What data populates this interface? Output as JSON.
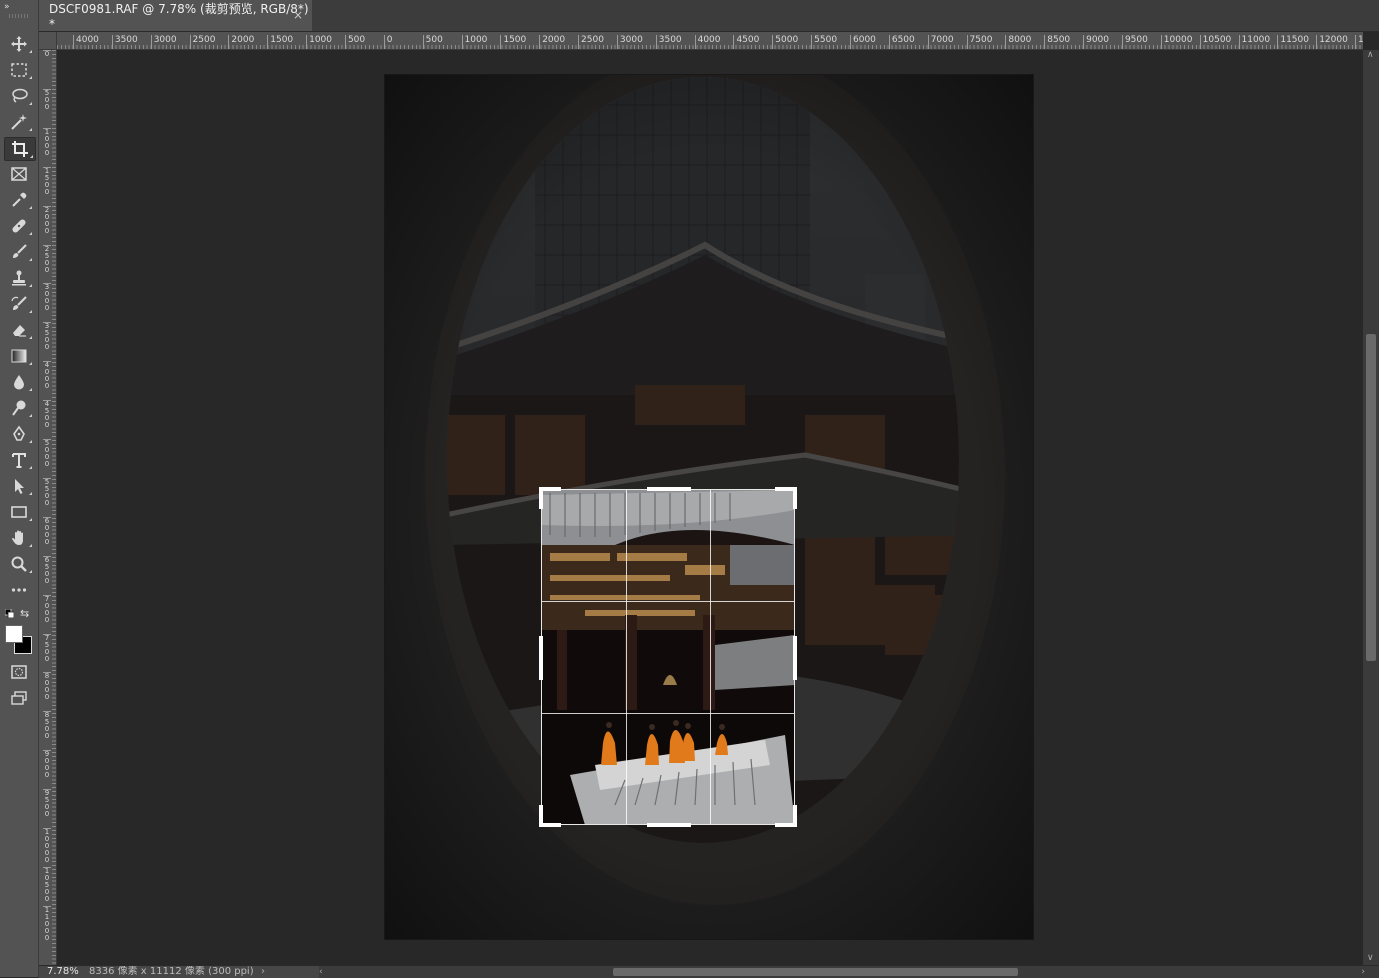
{
  "window": {
    "toolbar_collapse": "»",
    "tab_title": "DSCF0981.RAF @ 7.78% (裁剪预览, RGB/8*) *",
    "tab_close": "×"
  },
  "tools": [
    {
      "name": "move-tool",
      "icon": "move-icon"
    },
    {
      "name": "marquee-tool",
      "icon": "rect-marquee-icon"
    },
    {
      "name": "lasso-tool",
      "icon": "lasso-icon"
    },
    {
      "name": "magic-wand-tool",
      "icon": "magic-wand-icon"
    },
    {
      "name": "crop-tool",
      "icon": "crop-icon",
      "active": true
    },
    {
      "name": "frame-tool",
      "icon": "frame-icon"
    },
    {
      "name": "eyedropper-tool",
      "icon": "eyedropper-icon"
    },
    {
      "name": "healing-tool",
      "icon": "bandage-icon"
    },
    {
      "name": "brush-tool",
      "icon": "brush-icon"
    },
    {
      "name": "stamp-tool",
      "icon": "stamp-icon"
    },
    {
      "name": "history-brush-tool",
      "icon": "history-brush-icon"
    },
    {
      "name": "eraser-tool",
      "icon": "eraser-icon"
    },
    {
      "name": "gradient-tool",
      "icon": "gradient-icon"
    },
    {
      "name": "blur-tool",
      "icon": "drop-icon"
    },
    {
      "name": "dodge-tool",
      "icon": "dodge-icon"
    },
    {
      "name": "pen-tool",
      "icon": "pen-icon"
    },
    {
      "name": "type-tool",
      "icon": "type-icon"
    },
    {
      "name": "path-selection-tool",
      "icon": "arrow-select-icon"
    },
    {
      "name": "shape-tool",
      "icon": "rectangle-icon"
    },
    {
      "name": "hand-tool",
      "icon": "hand-icon"
    },
    {
      "name": "zoom-tool",
      "icon": "magnifier-icon"
    },
    {
      "name": "more-tools",
      "icon": "ellipsis-icon"
    }
  ],
  "colors": {
    "foreground": "#ffffff",
    "background": "#000000",
    "swap_glyph": "⇆"
  },
  "ruler": {
    "h_labels": [
      "4000",
      "3500",
      "3000",
      "2500",
      "2000",
      "1500",
      "1000",
      "500",
      "0",
      "500",
      "1000",
      "1500",
      "2000",
      "2500",
      "3000",
      "3500",
      "4000",
      "4500",
      "5000",
      "5500",
      "6000",
      "6500",
      "7000",
      "7500",
      "8000",
      "8500",
      "9000",
      "9500",
      "10000",
      "10500",
      "11000",
      "11500",
      "12000",
      "1"
    ],
    "v_labels": [
      "0",
      "5\n0\n0",
      "1\n0\n0\n0",
      "1\n5\n0\n0",
      "2\n0\n0\n0",
      "2\n5\n0\n0",
      "3\n0\n0\n0",
      "3\n5\n0\n0",
      "4\n0\n0\n0",
      "4\n5\n0\n0",
      "5\n0\n0\n0",
      "5\n5\n0\n0",
      "6\n0\n0\n0",
      "6\n5\n0\n0",
      "7\n0\n0\n0",
      "7\n5\n0\n0",
      "8\n0\n0\n0",
      "8\n5\n0\n0",
      "9\n0\n0\n0",
      "9\n5\n0\n0",
      "1\n0\n0\n0\n0",
      "1\n0\n5\n0\n0",
      "1\n1\n0\n0\n0"
    ]
  },
  "status": {
    "zoom": "7.78%",
    "doc_info": "8336 像素 x 11112 像素 (300 ppi)",
    "chevron": "›"
  },
  "scroll": {
    "up": "∧",
    "down": "∨",
    "left": "‹",
    "right": "›"
  }
}
